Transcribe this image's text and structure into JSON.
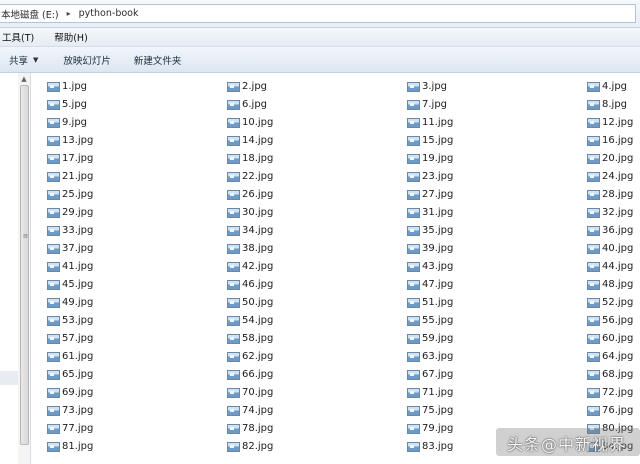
{
  "address": {
    "drive": "本地磁盘 (E:)",
    "separator": "▸",
    "folder": "python-book"
  },
  "menubar": {
    "tools": "工具(T)",
    "help": "帮助(H)"
  },
  "toolbar": {
    "share": "共享",
    "share_arrow": "▼",
    "slideshow": "放映幻灯片",
    "new_folder": "新建文件夹"
  },
  "navpane": {
    "scroll_up": "▲",
    "grip": "≡"
  },
  "files": [
    "1.jpg",
    "2.jpg",
    "3.jpg",
    "4.jpg",
    "5.jpg",
    "6.jpg",
    "7.jpg",
    "8.jpg",
    "9.jpg",
    "10.jpg",
    "11.jpg",
    "12.jpg",
    "13.jpg",
    "14.jpg",
    "15.jpg",
    "16.jpg",
    "17.jpg",
    "18.jpg",
    "19.jpg",
    "20.jpg",
    "21.jpg",
    "22.jpg",
    "23.jpg",
    "24.jpg",
    "25.jpg",
    "26.jpg",
    "27.jpg",
    "28.jpg",
    "29.jpg",
    "30.jpg",
    "31.jpg",
    "32.jpg",
    "33.jpg",
    "34.jpg",
    "35.jpg",
    "36.jpg",
    "37.jpg",
    "38.jpg",
    "39.jpg",
    "40.jpg",
    "41.jpg",
    "42.jpg",
    "43.jpg",
    "44.jpg",
    "45.jpg",
    "46.jpg",
    "47.jpg",
    "48.jpg",
    "49.jpg",
    "50.jpg",
    "51.jpg",
    "52.jpg",
    "53.jpg",
    "54.jpg",
    "55.jpg",
    "56.jpg",
    "57.jpg",
    "58.jpg",
    "59.jpg",
    "60.jpg",
    "61.jpg",
    "62.jpg",
    "63.jpg",
    "64.jpg",
    "65.jpg",
    "66.jpg",
    "67.jpg",
    "68.jpg",
    "69.jpg",
    "70.jpg",
    "71.jpg",
    "72.jpg",
    "73.jpg",
    "74.jpg",
    "75.jpg",
    "76.jpg",
    "77.jpg",
    "78.jpg",
    "79.jpg",
    "80.jpg",
    "81.jpg",
    "82.jpg",
    "83.jpg",
    "84.jpg"
  ],
  "file_icon": "jpg-image-icon",
  "watermark": "头条@中新视界"
}
